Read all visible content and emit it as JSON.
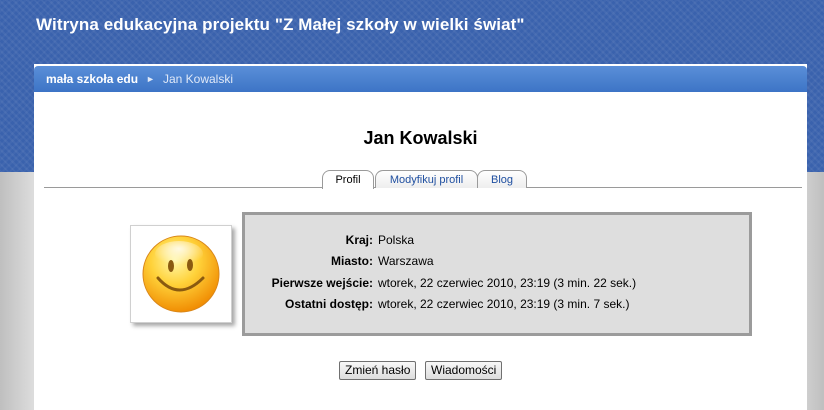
{
  "site": {
    "title": "Witryna edukacyjna projektu \"Z Małej szkoły w wielki świat\""
  },
  "breadcrumb": {
    "home": "mała szkoła edu",
    "separator": "►",
    "current": "Jan Kowalski"
  },
  "profile": {
    "name": "Jan Kowalski"
  },
  "tabs": [
    {
      "label": "Profil",
      "active": true
    },
    {
      "label": "Modyfikuj profil",
      "active": false
    },
    {
      "label": "Blog",
      "active": false
    }
  ],
  "avatar": {
    "icon": "smiley-icon"
  },
  "info": [
    {
      "label": "Kraj:",
      "value": "Polska"
    },
    {
      "label": "Miasto:",
      "value": "Warszawa"
    },
    {
      "label": "Pierwsze wejście:",
      "value": "wtorek, 22 czerwiec 2010, 23:19  (3 min. 22 sek.)"
    },
    {
      "label": "Ostatni dostęp:",
      "value": "wtorek, 22 czerwiec 2010, 23:19  (3 min. 7 sek.)"
    }
  ],
  "buttons": {
    "change_password": "Zmień hasło",
    "messages": "Wiadomości"
  },
  "colors": {
    "header": "#3a62ad",
    "navbar": "#4a80cf",
    "link": "#1f4fa0"
  }
}
